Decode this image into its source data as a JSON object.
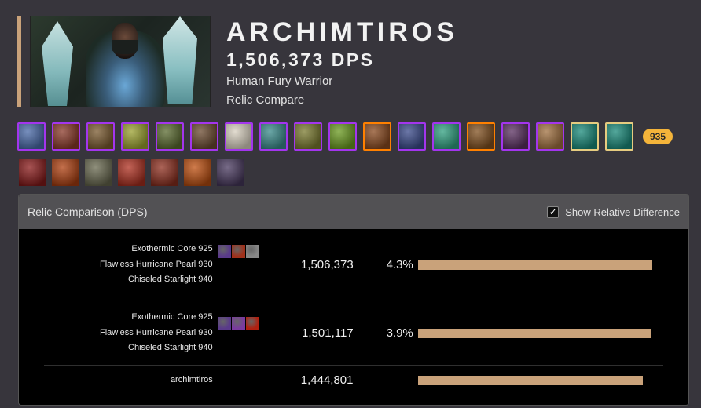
{
  "character": {
    "name": "ARCHIMTIROS",
    "dps": "1,506,373 DPS",
    "spec": "Human Fury Warrior",
    "mode": "Relic Compare"
  },
  "gear": [
    {
      "icon": "helm-icon",
      "quality": "epic",
      "color": "#4a6aa8"
    },
    {
      "icon": "necklace-icon",
      "quality": "epic",
      "color": "#8a3a2a"
    },
    {
      "icon": "shoulder-icon",
      "quality": "epic",
      "color": "#7a5a30"
    },
    {
      "icon": "cloak-icon",
      "quality": "epic",
      "color": "#9aa030"
    },
    {
      "icon": "chest-icon",
      "quality": "epic",
      "color": "#5a6a30"
    },
    {
      "icon": "shirt-icon",
      "quality": "epic",
      "color": "#6a4a30"
    },
    {
      "icon": "tabard-icon",
      "quality": "epic",
      "color": "#d8d0c0"
    },
    {
      "icon": "bracer-icon",
      "quality": "epic",
      "color": "#3a8a8a"
    },
    {
      "icon": "gloves-icon",
      "quality": "epic",
      "color": "#7a7a30"
    },
    {
      "icon": "belt-icon",
      "quality": "epic",
      "color": "#6a9a20"
    },
    {
      "icon": "legs-icon",
      "quality": "legendary",
      "color": "#8a4a20"
    },
    {
      "icon": "boots-icon",
      "quality": "epic",
      "color": "#3a4a8a"
    },
    {
      "icon": "ring-icon",
      "quality": "epic",
      "color": "#30a080"
    },
    {
      "icon": "ring-2-icon",
      "quality": "legendary",
      "color": "#805020"
    },
    {
      "icon": "trinket-icon",
      "quality": "epic",
      "color": "#5a3060"
    },
    {
      "icon": "trinket-2-icon",
      "quality": "epic",
      "color": "#a07040"
    },
    {
      "icon": "weapon-icon",
      "quality": "artifact",
      "color": "#1a8a7a"
    },
    {
      "icon": "offhand-icon",
      "quality": "artifact",
      "color": "#1a8a7a"
    }
  ],
  "item_level": "935",
  "talents": [
    {
      "icon": "talent-1-icon",
      "color": "#8a1a1a"
    },
    {
      "icon": "talent-2-icon",
      "color": "#b04010"
    },
    {
      "icon": "talent-3-icon",
      "color": "#6a6a50"
    },
    {
      "icon": "talent-4-icon",
      "color": "#b03020"
    },
    {
      "icon": "talent-5-icon",
      "color": "#903020"
    },
    {
      "icon": "talent-6-icon",
      "color": "#c05010"
    },
    {
      "icon": "talent-7-icon",
      "color": "#4a3a60"
    }
  ],
  "panel": {
    "title": "Relic Comparison (DPS)",
    "toggle_label": "Show Relative Difference",
    "toggle_checked": "✓"
  },
  "rows": [
    {
      "relics": [
        "Exothermic Core 925",
        "Flawless Hurricane Pearl 930",
        "Chiseled Starlight 940"
      ],
      "relic_icons": [
        {
          "name": "relic-fel-icon",
          "color": "#5a3a8a"
        },
        {
          "name": "relic-fire-icon",
          "color": "#a0301a"
        },
        {
          "name": "relic-iron-icon",
          "color": "#888888"
        }
      ],
      "dps": "1,506,373",
      "pct": "4.3%",
      "value": 1506373
    },
    {
      "relics": [
        "Exothermic Core 925",
        "Flawless Hurricane Pearl 930",
        "Chiseled Starlight 940"
      ],
      "relic_icons": [
        {
          "name": "relic-fel-icon",
          "color": "#5a3a8a"
        },
        {
          "name": "relic-shadow-icon",
          "color": "#7a3aa0"
        },
        {
          "name": "relic-blood-icon",
          "color": "#b02010"
        }
      ],
      "dps": "1,501,117",
      "pct": "3.9%",
      "value": 1501117
    },
    {
      "relics": [
        "archimtiros"
      ],
      "relic_icons": [],
      "dps": "1,444,801",
      "pct": "",
      "value": 1444801
    }
  ]
}
